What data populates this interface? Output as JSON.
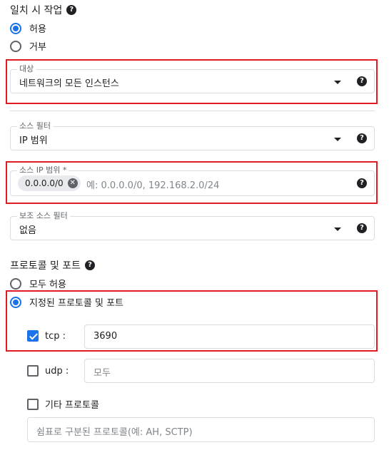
{
  "match_action": {
    "heading": "일치 시 작업",
    "options": [
      "허용",
      "거부"
    ],
    "selected": "허용"
  },
  "targets": {
    "label": "대상",
    "value": "네트워크의 모든 인스턴스"
  },
  "source_filter": {
    "label": "소스 필터",
    "value": "IP 범위"
  },
  "source_ip_ranges": {
    "label": "소스 IP 범위 *",
    "chip": "0.0.0.0/0",
    "placeholder": "예: 0.0.0.0/0, 192.168.2.0/24"
  },
  "secondary_source_filter": {
    "label": "보조 소스 필터",
    "value": "없음"
  },
  "protocols_ports": {
    "heading": "프로토콜 및 포트",
    "options": [
      "모두 허용",
      "지정된 프로토콜 및 포트"
    ],
    "selected": "지정된 프로토콜 및 포트",
    "tcp": {
      "label": "tcp :",
      "checked": true,
      "value": "3690"
    },
    "udp": {
      "label": "udp :",
      "checked": false,
      "placeholder": "모두"
    },
    "other": {
      "label": "기타 프로토콜",
      "checked": false,
      "placeholder": "쉼표로 구분된 프로토콜(예: AH, SCTP)"
    }
  },
  "icons": {
    "help": "?",
    "chip_remove": "✕"
  },
  "colors": {
    "accent": "#1a73e8",
    "highlight": "#e01b24"
  }
}
